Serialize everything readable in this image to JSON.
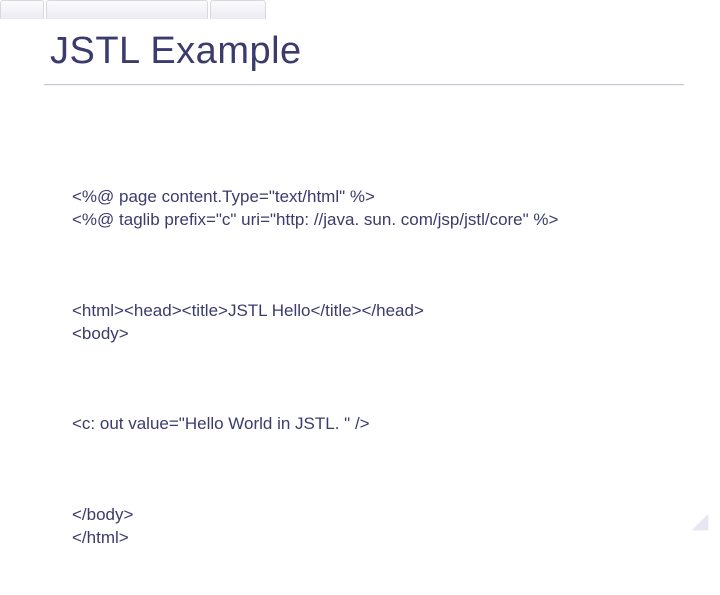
{
  "title": "JSTL Example",
  "code": {
    "block1": "<%@ page content.Type=\"text/html\" %>\n<%@ taglib prefix=\"c\" uri=\"http: //java. sun. com/jsp/jstl/core\" %>",
    "block2": "<html><head><title>JSTL Hello</title></head>\n<body>",
    "block3": "<c: out value=\"Hello World in JSTL. \" />",
    "block4": "</body>\n</html>"
  },
  "tabs": [
    42,
    160,
    54
  ]
}
